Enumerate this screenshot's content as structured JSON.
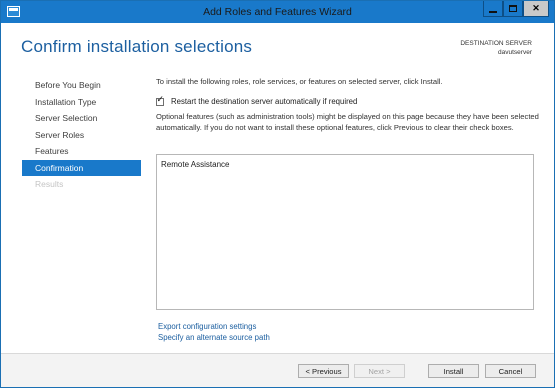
{
  "window": {
    "title": "Add Roles and Features Wizard",
    "accent_color": "#1979ca"
  },
  "header": {
    "page_title": "Confirm installation selections",
    "destination_label": "DESTINATION SERVER",
    "destination_value": "davutserver"
  },
  "nav": {
    "items": [
      {
        "label": "Before You Begin",
        "state": "normal"
      },
      {
        "label": "Installation Type",
        "state": "normal"
      },
      {
        "label": "Server Selection",
        "state": "normal"
      },
      {
        "label": "Server Roles",
        "state": "normal"
      },
      {
        "label": "Features",
        "state": "normal"
      },
      {
        "label": "Confirmation",
        "state": "active"
      },
      {
        "label": "Results",
        "state": "disabled"
      }
    ]
  },
  "main": {
    "intro": "To install the following roles, role services, or features on selected server, click Install.",
    "restart_checkbox": {
      "label": "Restart the destination server automatically if required",
      "checked": true
    },
    "optional_note": "Optional features (such as administration tools) might be displayed on this page because they have been selected automatically. If you do not want to install these optional features, click Previous to clear their check boxes.",
    "features": [
      "Remote Assistance"
    ],
    "links": {
      "export": "Export configuration settings",
      "source": "Specify an alternate source path"
    }
  },
  "footer": {
    "previous": "< Previous",
    "next": "Next >",
    "install": "Install",
    "cancel": "Cancel"
  }
}
